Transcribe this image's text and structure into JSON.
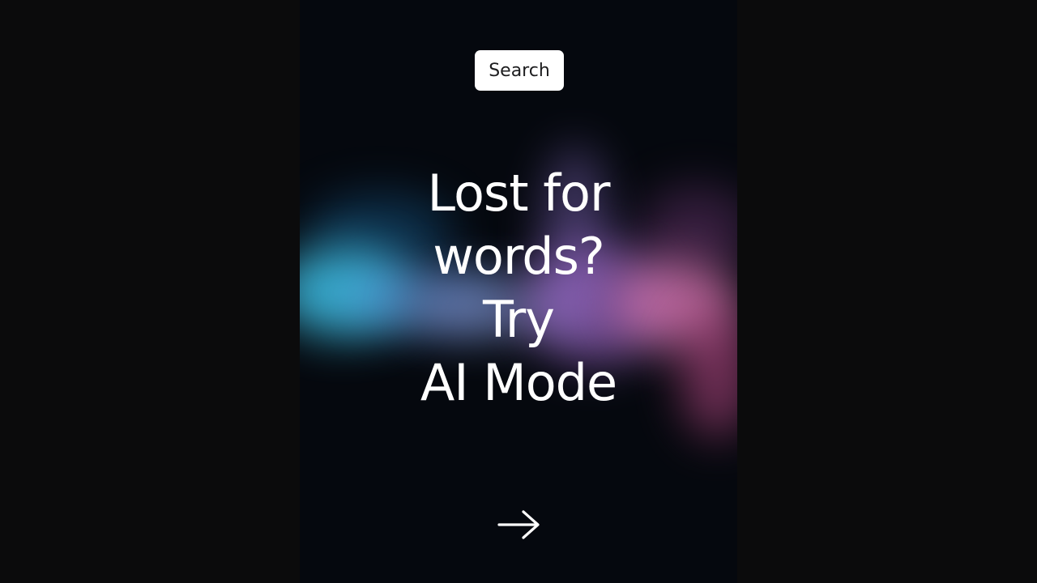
{
  "header": {
    "search_label": "Search"
  },
  "headline": {
    "lines": [
      "Lost for",
      "words?",
      "Try",
      "AI Mode"
    ]
  },
  "footer": {
    "arrow_icon": "arrow-right-icon"
  },
  "colors": {
    "page_background": "#0b0b0c",
    "panel_background": "#05080e",
    "text": "#ffffff",
    "button_background": "#ffffff",
    "glow_cyan": "#3fc3ea",
    "glow_purple": "#a86fd6",
    "glow_pink": "#e07ab8"
  }
}
